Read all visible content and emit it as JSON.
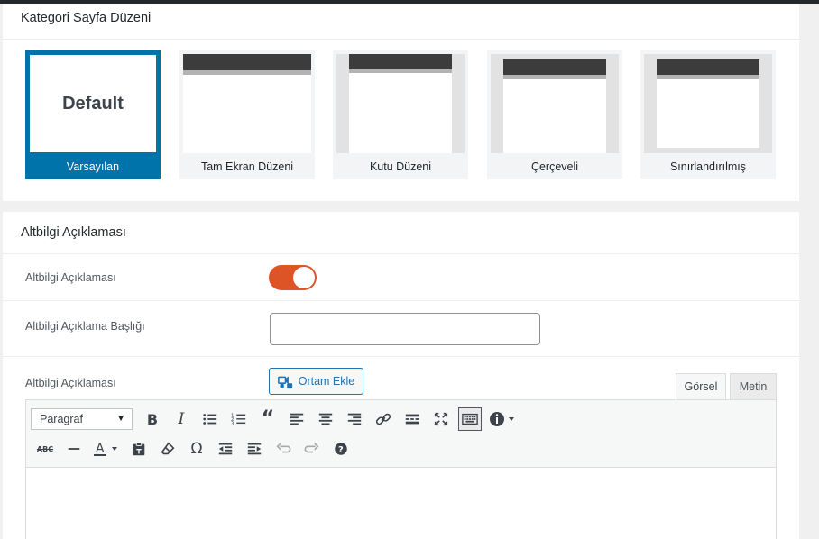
{
  "layout_panel": {
    "title": "Kategori Sayfa Düzeni",
    "options": [
      {
        "label": "Varsayılan",
        "preview_text": "Default",
        "selected": true
      },
      {
        "label": "Tam Ekran Düzeni",
        "selected": false
      },
      {
        "label": "Kutu Düzeni",
        "selected": false
      },
      {
        "label": "Çerçeveli",
        "selected": false
      },
      {
        "label": "Sınırlandırılmış",
        "selected": false
      }
    ]
  },
  "footer_panel": {
    "title": "Altbilgi Açıklaması",
    "toggle_row": {
      "label": "Altbilgi Açıklaması",
      "enabled": true
    },
    "heading_row": {
      "label": "Altbilgi Açıklama Başlığı",
      "value": ""
    },
    "editor_row": {
      "label": "Altbilgi Açıklaması",
      "media_button": "Ortam Ekle",
      "tabs": [
        "Görsel",
        "Metin"
      ],
      "active_tab": "Görsel",
      "format_select": "Paragraf"
    }
  },
  "colors": {
    "accent": "#0073aa",
    "toggle_on": "#dd5426",
    "button_blue": "#2271b1"
  },
  "icons": {
    "toolbar_row1": [
      "bold-icon",
      "italic-icon",
      "bullet-list-icon",
      "numbered-list-icon",
      "blockquote-icon",
      "align-left-icon",
      "align-center-icon",
      "align-right-icon",
      "link-icon",
      "read-more-icon",
      "fullscreen-icon",
      "toolbar-toggle-icon",
      "info-icon"
    ],
    "toolbar_row2": [
      "strikethrough-icon",
      "horizontal-line-icon",
      "text-color-icon",
      "paste-text-icon",
      "clear-formatting-icon",
      "special-char-icon",
      "outdent-icon",
      "indent-icon",
      "undo-icon",
      "redo-icon",
      "help-icon"
    ]
  }
}
